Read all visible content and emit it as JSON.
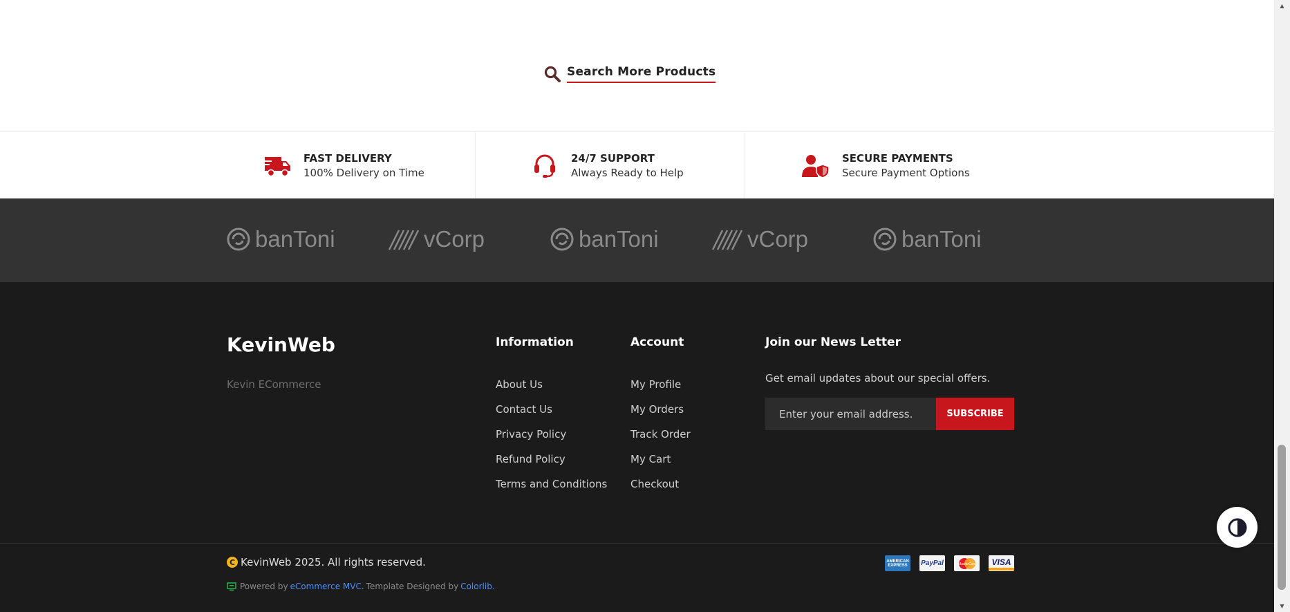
{
  "search": {
    "label": "Search More Products"
  },
  "features": [
    {
      "title": "FAST DELIVERY",
      "desc": "100% Delivery on Time",
      "icon": "truck-icon"
    },
    {
      "title": "24/7 SUPPORT",
      "desc": "Always Ready to Help",
      "icon": "headset-icon"
    },
    {
      "title": "SECURE PAYMENTS",
      "desc": "Secure Payment Options",
      "icon": "user-shield-icon"
    }
  ],
  "brands": [
    "banToni",
    "vCorp",
    "banToni",
    "vCorp",
    "banToni"
  ],
  "footer": {
    "logo": "KevinWeb",
    "tagline": "Kevin ECommerce",
    "information": {
      "title": "Information",
      "links": [
        "About Us",
        "Contact Us",
        "Privacy Policy",
        "Refund Policy",
        "Terms and Conditions"
      ]
    },
    "account": {
      "title": "Account",
      "links": [
        "My Profile",
        "My Orders",
        "Track Order",
        "My Cart",
        "Checkout"
      ]
    },
    "newsletter": {
      "title": "Join our News Letter",
      "desc": "Get email updates about our special offers.",
      "placeholder": "Enter your email address.",
      "button": "SUBSCRIBE"
    },
    "copyright": "KevinWeb 2025. All rights reserved.",
    "powered_prefix": "Powered by",
    "powered_link": "eCommerce MVC.",
    "designed_prefix": "Template Designed by",
    "designed_link": "Colorlib.",
    "payment_cards": [
      {
        "name": "amex-card-icon",
        "label": "AMERICAN EXPRESS"
      },
      {
        "name": "paypal-card-icon",
        "label": "PayPal"
      },
      {
        "name": "mastercard-card-icon",
        "label": "MasterCard"
      },
      {
        "name": "visa-card-icon",
        "label": "VISA"
      }
    ]
  },
  "colors": {
    "accent": "#c8161d",
    "footer_bg": "#1b1b1b",
    "brands_bg": "#333333",
    "link": "#4d8cf5"
  }
}
